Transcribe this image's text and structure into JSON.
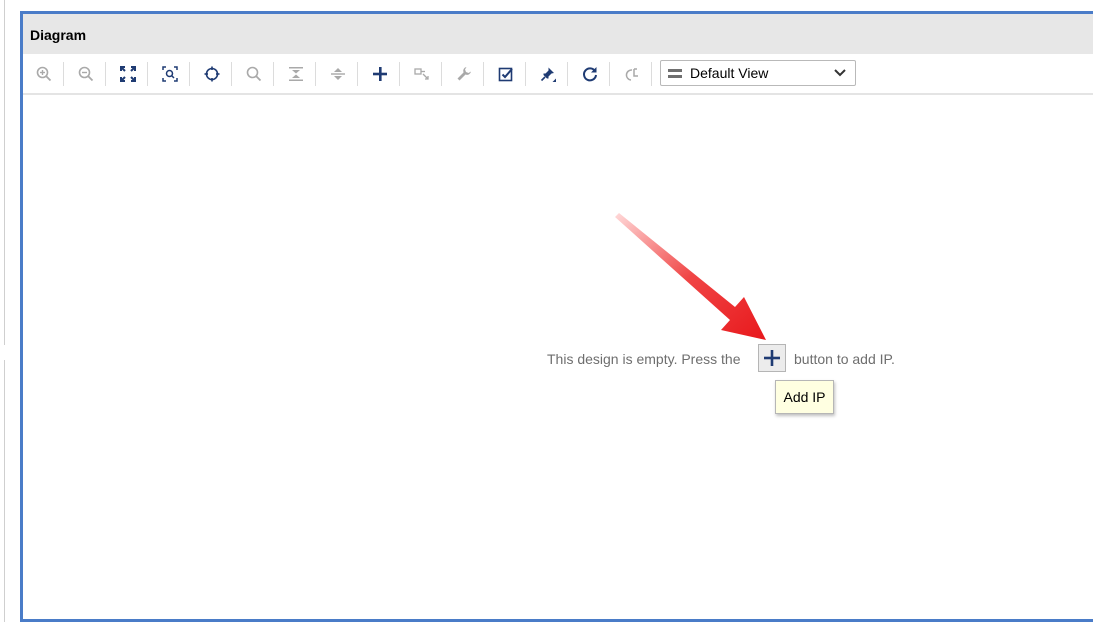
{
  "panel": {
    "title": "Diagram"
  },
  "toolbar": {
    "buttons": [
      {
        "icon": "zoom-in-icon",
        "enabled": false
      },
      {
        "icon": "zoom-out-icon",
        "enabled": false
      },
      {
        "icon": "zoom-fit-icon",
        "enabled": true
      },
      {
        "icon": "zoom-selection-icon",
        "enabled": true
      },
      {
        "icon": "auto-connect-icon",
        "enabled": true
      },
      {
        "icon": "search-icon",
        "enabled": false
      },
      {
        "icon": "collapse-all-icon",
        "enabled": false
      },
      {
        "icon": "expand-all-icon",
        "enabled": false
      },
      {
        "icon": "add-ip-icon",
        "enabled": true
      },
      {
        "icon": "make-external-icon",
        "enabled": false
      },
      {
        "icon": "properties-wrench-icon",
        "enabled": false
      },
      {
        "icon": "validate-design-icon",
        "enabled": true
      },
      {
        "icon": "pin-icon",
        "enabled": true
      },
      {
        "icon": "regenerate-layout-icon",
        "enabled": true
      },
      {
        "icon": "optimize-routing-icon",
        "enabled": false
      }
    ],
    "view_select": {
      "value": "Default View"
    }
  },
  "canvas": {
    "empty_msg_before": "This design is empty. Press the",
    "empty_msg_after": "button to add IP.",
    "tooltip": "Add IP"
  },
  "colors": {
    "panel_border": "#4a7cc8",
    "icon_enabled": "#1f3b73",
    "icon_disabled": "#a9a9a9",
    "tooltip_bg": "#ffffe1",
    "arrow": "#e8181c"
  }
}
